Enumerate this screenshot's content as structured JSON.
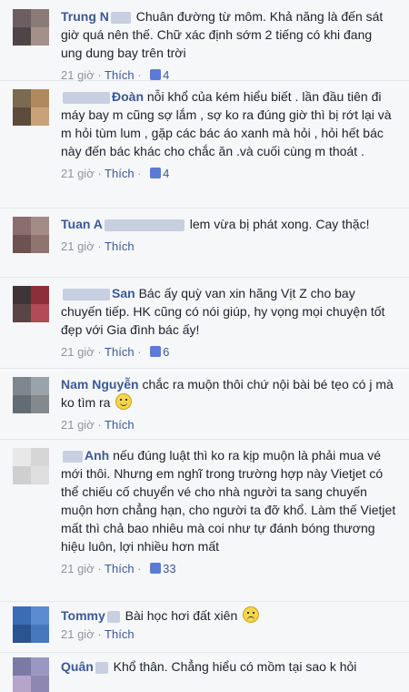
{
  "comments": [
    {
      "author": "Trung N",
      "text": "Chuân đường từ môm. Khả năng là đến sát giờ quá nên thế. Chữ xác định sớm 2 tiếng có khi đang ung dung bay trên trời",
      "time": "21 giờ",
      "like_label": "Thích",
      "likes": "4"
    },
    {
      "author": "Đoàn",
      "text": "nỗi khổ của kém hiểu biết . lần đầu tiên đi máy bay m cũng sợ lắm , sợ ko ra đúng giờ thì bị rớt lại và m hỏi tùm lum , gặp các bác áo xanh mà hỏi , hỏi hết bác này đến bác khác cho chắc ăn .và cuối cùng m thoát .",
      "time": "21 giờ",
      "like_label": "Thích",
      "likes": "4"
    },
    {
      "author": "Tuan A",
      "text": "lem vừa bị phát xong. Cay thặc!",
      "time": "21 giờ",
      "like_label": "Thích"
    },
    {
      "author": "San",
      "text": "Bác ấy quỳ van xin hãng Vịt Z cho bay chuyến tiếp. HK cũng có nói giúp, hy vọng mọi chuyện tốt đẹp với Gia đình bác ấy!",
      "time": "21 giờ",
      "like_label": "Thích",
      "likes": "6"
    },
    {
      "author": "Nam Nguyễn",
      "text": "chắc ra muộn thôi chứ nội bài bé tẹo có j mà ko tìm ra",
      "emoji": "smile",
      "time": "21 giờ",
      "like_label": "Thích"
    },
    {
      "author": "Anh",
      "text": "nếu đúng luật thì ko ra kịp muộn là phải mua vé mới thôi. Nhưng em nghĩ trong trường hợp này Vietjet có thể chiếu cố chuyển vé cho nhà người ta sang chuyến muộn hơn chẳng hạn, cho người ta đỡ khổ. Làm thế Vietjet mất thì chả bao nhiêu mà coi như tự đánh bóng thương hiệu luôn, lợi nhiều hơn mất",
      "time": "21 giờ",
      "like_label": "Thích",
      "likes": "33"
    },
    {
      "author": "Tommy",
      "text": "Bài học hơi đất xiên",
      "emoji": "frown",
      "time": "21 giờ",
      "like_label": "Thích"
    },
    {
      "author": "Quân",
      "text": "Khổ thân. Chẳng hiểu có mồm tại sao k hỏi"
    }
  ]
}
